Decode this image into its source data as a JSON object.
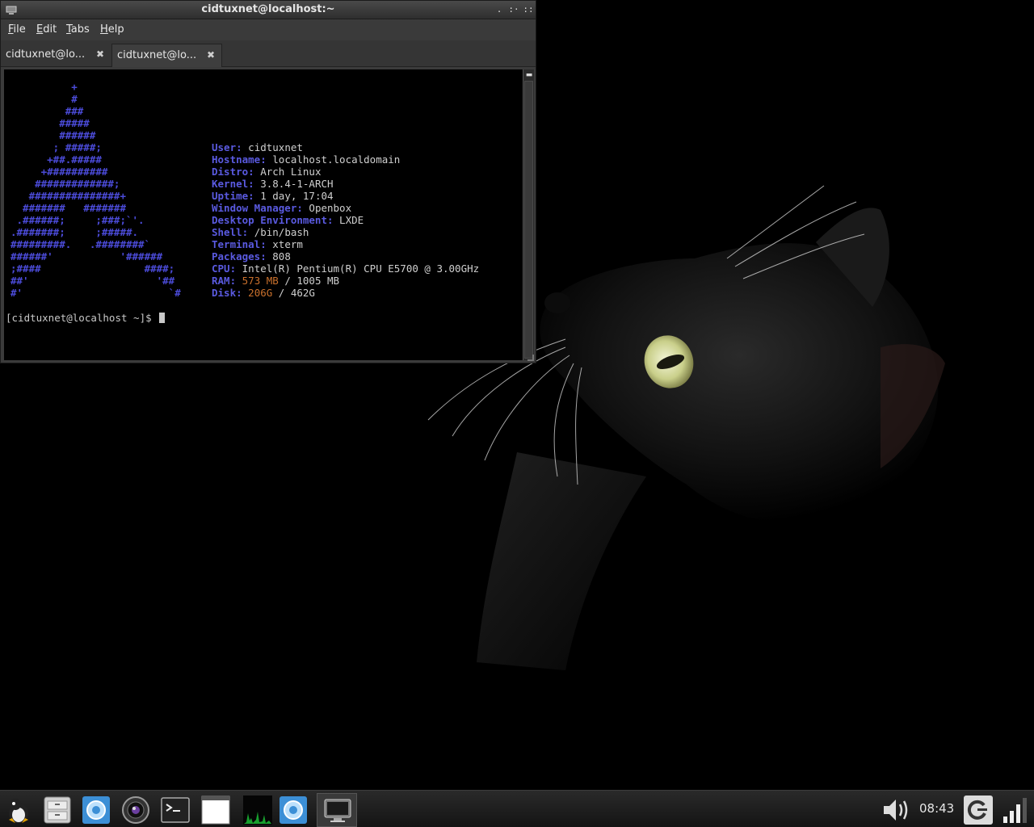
{
  "window": {
    "title": "cidtuxnet@localhost:~",
    "menu": [
      "File",
      "Edit",
      "Tabs",
      "Help"
    ],
    "menu_mnemonics": [
      "F",
      "E",
      "T",
      "H"
    ],
    "tabs": [
      {
        "label": "cidtuxnet@lo...",
        "active": false
      },
      {
        "label": "cidtuxnet@lo...",
        "active": true
      }
    ]
  },
  "terminal": {
    "logo": [
      "          +",
      "          #",
      "         ###",
      "        #####",
      "        ######",
      "       ; #####;",
      "      +##.#####",
      "     +##########",
      "    #############;",
      "   ###############+",
      "  #######   #######",
      " .######;     ;###;`'.",
      ".#######;     ;#####.",
      "#########.   .########`",
      "######'           '######",
      ";####                 ####;",
      "##'                     '##",
      "#'                        `#"
    ],
    "info": [
      {
        "key": "User:",
        "value": "cidtuxnet"
      },
      {
        "key": "Hostname:",
        "value": "localhost.localdomain"
      },
      {
        "key": "Distro:",
        "value": "Arch Linux"
      },
      {
        "key": "Kernel:",
        "value": "3.8.4-1-ARCH"
      },
      {
        "key": "Uptime:",
        "value": "1 day, 17:04"
      },
      {
        "key": "Window Manager:",
        "value": "Openbox"
      },
      {
        "key": "Desktop Environment:",
        "value": "LXDE"
      },
      {
        "key": "Shell:",
        "value": "/bin/bash"
      },
      {
        "key": "Terminal:",
        "value": "xterm"
      },
      {
        "key": "Packages:",
        "value": "808"
      },
      {
        "key": "CPU:",
        "value": "Intel(R) Pentium(R) CPU E5700 @ 3.00GHz"
      },
      {
        "key": "RAM:",
        "used": "573 MB",
        "sep": " / ",
        "total": "1005 MB"
      },
      {
        "key": "Disk:",
        "used": "206G",
        "sep": " / ",
        "total": "462G"
      }
    ],
    "prompt": "[cidtuxnet@localhost ~]$ "
  },
  "taskbar": {
    "clock": "08:43",
    "launchers": [
      "menu-penguin-icon",
      "file-manager-icon",
      "browser-icon",
      "camera-icon",
      "terminal-icon",
      "blank-window-icon",
      "cpu-monitor-icon",
      "browser-icon-2",
      "show-desktop-icon"
    ],
    "tray": [
      "volume-icon",
      "power-icon",
      "network-signal-icon"
    ]
  },
  "colors": {
    "logo_blue": "#4b4bd8",
    "key_blue": "#5a5ae0",
    "value_orange": "#c9702c",
    "terminal_bg": "#000000"
  }
}
